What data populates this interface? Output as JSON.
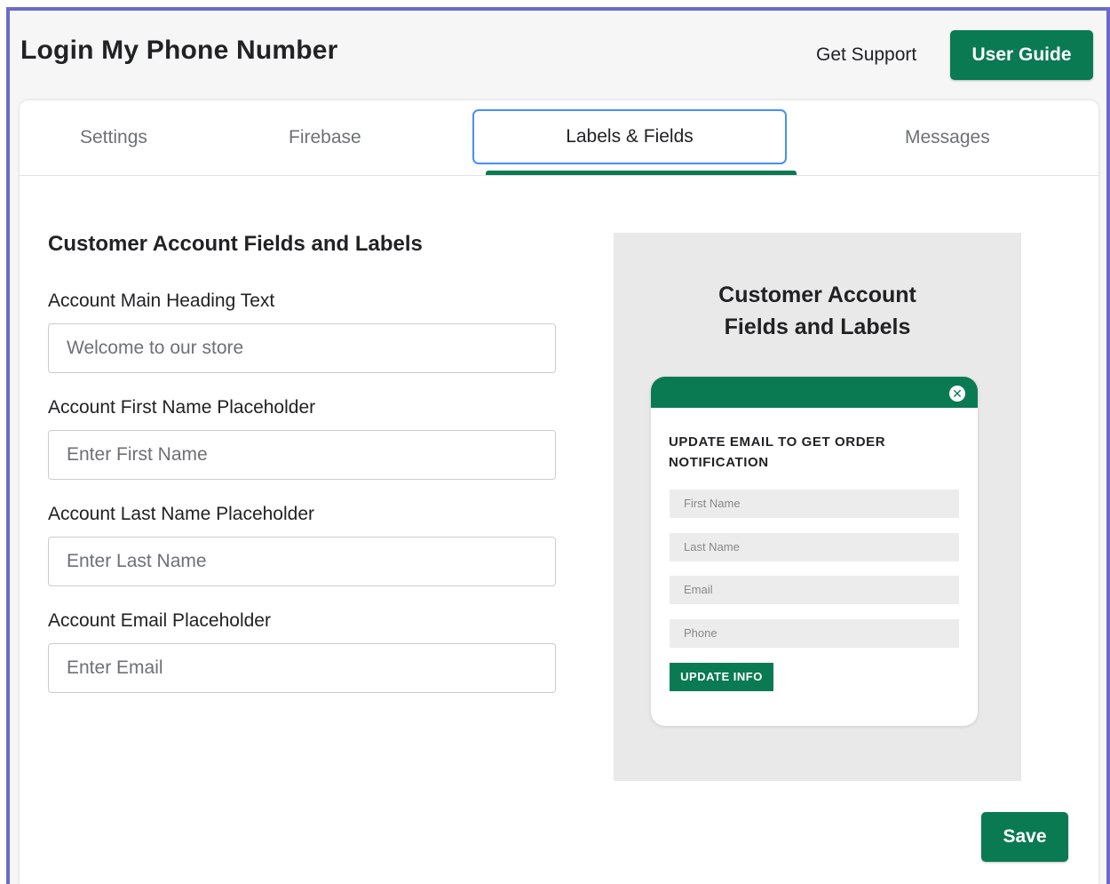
{
  "header": {
    "title": "Login My Phone Number",
    "support_link": "Get Support",
    "user_guide_button": "User Guide"
  },
  "tabs": [
    {
      "label": "Settings"
    },
    {
      "label": "Firebase"
    },
    {
      "label": "Labels & Fields",
      "active": true
    },
    {
      "label": "Messages"
    }
  ],
  "form": {
    "section_heading": "Customer Account Fields and Labels",
    "fields": [
      {
        "label": "Account Main Heading Text",
        "placeholder": "Welcome to our store"
      },
      {
        "label": "Account First Name Placeholder",
        "placeholder": "Enter First Name"
      },
      {
        "label": "Account Last Name Placeholder",
        "placeholder": "Enter Last Name"
      },
      {
        "label": "Account Email Placeholder",
        "placeholder": "Enter Email"
      }
    ],
    "save_button": "Save"
  },
  "preview": {
    "heading_line1": "Customer Account",
    "heading_line2": "Fields and Labels",
    "popup": {
      "close_icon": "close-circle-icon",
      "title": "UPDATE EMAIL TO GET ORDER NOTIFICATION",
      "fields": [
        "First Name",
        "Last Name",
        "Email",
        "Phone"
      ],
      "button": "UPDATE INFO"
    }
  },
  "colors": {
    "accent": "#0a7a53",
    "focus_ring": "#458fff",
    "window_border": "#6b6bc9"
  }
}
